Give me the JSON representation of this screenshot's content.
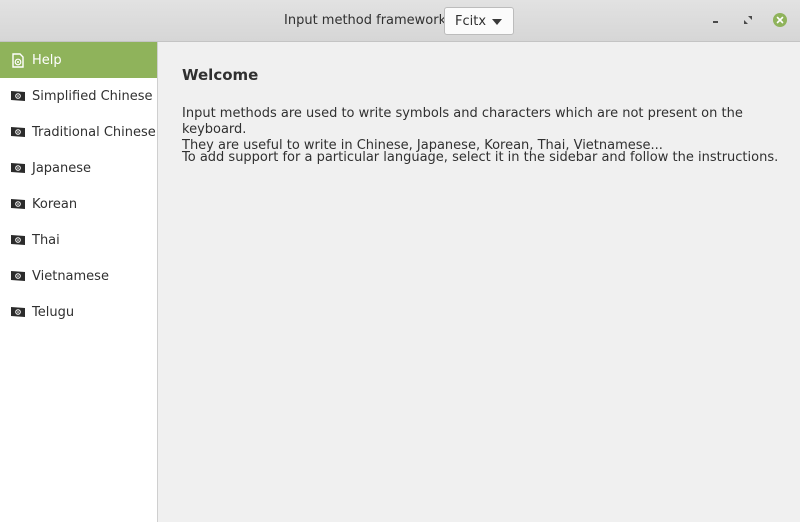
{
  "header": {
    "framework_label": "Input method framework:",
    "framework_selected": "Fcitx"
  },
  "window_controls": {
    "minimize_icon": "minimize-icon",
    "restore_icon": "restore-icon",
    "close_icon": "close-icon"
  },
  "sidebar": {
    "items": [
      {
        "label": "Help",
        "icon": "help-icon",
        "active": true
      },
      {
        "label": "Simplified Chinese",
        "icon": "flag-icon"
      },
      {
        "label": "Traditional Chinese",
        "icon": "flag-icon"
      },
      {
        "label": "Japanese",
        "icon": "flag-icon"
      },
      {
        "label": "Korean",
        "icon": "flag-icon"
      },
      {
        "label": "Thai",
        "icon": "flag-icon"
      },
      {
        "label": "Vietnamese",
        "icon": "flag-icon"
      },
      {
        "label": "Telugu",
        "icon": "flag-icon"
      }
    ]
  },
  "main": {
    "title": "Welcome",
    "line1": "Input methods are used to write symbols and characters which are not present on the keyboard.",
    "line2": "They are useful to write in Chinese, Japanese, Korean, Thai, Vietnamese...",
    "line3": "To add support for a particular language, select it in the sidebar and follow the instructions."
  },
  "colors": {
    "accent": "#8fb35b",
    "sidebar_bg": "#ffffff",
    "content_bg": "#f0f0f0"
  }
}
